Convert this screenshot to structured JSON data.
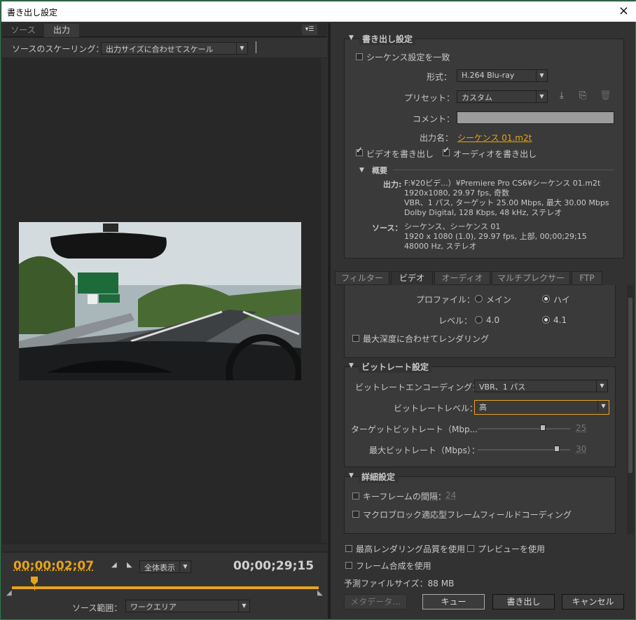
{
  "window": {
    "title": "書き出し設定",
    "close": "×"
  },
  "left": {
    "tabs": [
      "ソース",
      "出力"
    ],
    "panel_menu": "▾☰",
    "scaling_label": "ソースのスケーリング：",
    "scaling_value": "出力サイズに合わせてスケール",
    "timecode_current": "00;00;02;07",
    "timecode_total": "00;00;29;15",
    "zoom_value": "全体表示",
    "range_label": "ソース範囲：",
    "range_value": "ワークエリア"
  },
  "export": {
    "section_title": "書き出し設定",
    "match_sequence": "シーケンス設定を一致",
    "format_label": "形式：",
    "format_value": "H.264 Blu-ray",
    "preset_label": "プリセット：",
    "preset_value": "カスタム",
    "comment_label": "コメント：",
    "output_name_label": "出力名：",
    "output_name_value": "シーケンス 01.m2t",
    "export_video": "ビデオを書き出し",
    "export_audio": "オーディオを書き出し",
    "summary_title": "概要",
    "out_label": "出力:",
    "out_lines": [
      "F:¥20ビデ...）¥Premiere Pro CS6¥シーケンス 01.m2t",
      "1920x1080, 29.97 fps, 奇数",
      "VBR、1 パス, ターゲット 25.00 Mbps, 最大 30.00 Mbps",
      "Dolby Digital, 128 Kbps, 48 kHz, ステレオ"
    ],
    "src_label": "ソース：",
    "src_lines": [
      "シーケンス、シーケンス 01",
      "1920 x 1080 (1.0), 29.97 fps, 上部, 00;00;29;15",
      "48000 Hz, ステレオ"
    ]
  },
  "tabs": [
    "フィルター",
    "ビデオ",
    "オーディオ",
    "マルチプレクサー",
    "FTP"
  ],
  "video": {
    "profile_label": "プロファイル：",
    "profile_main": "メイン",
    "profile_high": "ハイ",
    "level_label": "レベル：",
    "level_a": "4.0",
    "level_b": "4.1",
    "max_depth": "最大深度に合わせてレンダリング",
    "bitrate_title": "ビットレート設定",
    "enc_label": "ビットレートエンコーディング：",
    "enc_value": "VBR、1 パス",
    "bitrate_level_label": "ビットレートレベル：",
    "bitrate_level_value": "高",
    "target_label": "ターゲットビットレート（Mbp...",
    "target_value": "25",
    "max_label": "最大ビットレート（Mbps）：",
    "max_value": "30",
    "advanced_title": "詳細設定",
    "keyframe_label": "キーフレームの間隔：",
    "keyframe_value": "24",
    "macroblock": "マクロブロック適応型フレームフィールドコーディング",
    "target_fraction": 0.72,
    "max_fraction": 0.88
  },
  "bottom": {
    "max_render": "最高レンダリング品質を使用",
    "use_preview": "プレビューを使用",
    "frame_blend": "フレーム合成を使用",
    "file_size": "予測ファイルサイズ：88 MB",
    "metadata": "メタデータ...",
    "queue": "キュー",
    "export": "書き出し",
    "cancel": "キャンセル"
  },
  "colors": {
    "accent": "#e8a317",
    "bg": "#323232"
  }
}
